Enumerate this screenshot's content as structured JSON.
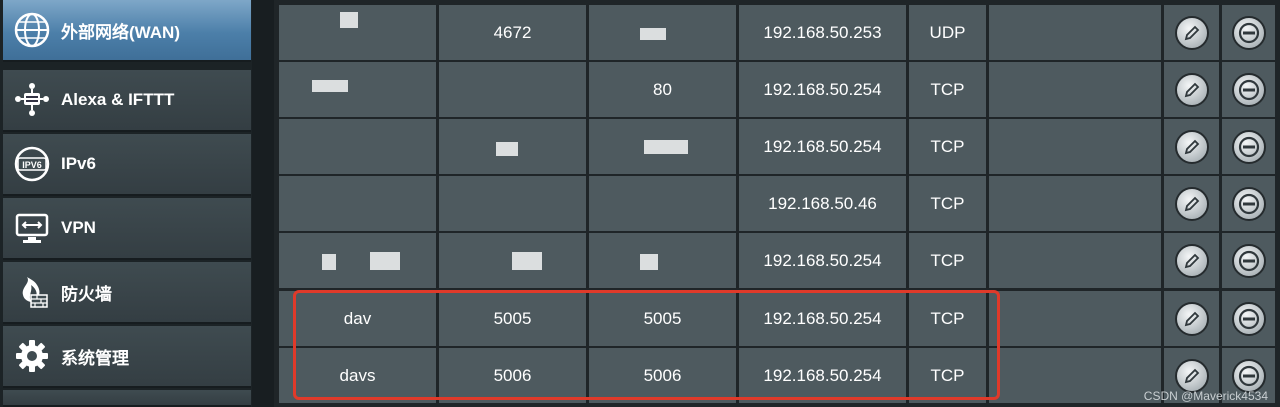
{
  "sidebar": {
    "items": [
      {
        "label": "外部网络(WAN)",
        "icon": "globe-icon",
        "active": true
      },
      {
        "label": "Alexa & IFTTT",
        "icon": "alexa-device-icon",
        "active": false
      },
      {
        "label": "IPv6",
        "icon": "ipv6-icon",
        "active": false
      },
      {
        "label": "VPN",
        "icon": "vpn-monitor-icon",
        "active": false
      },
      {
        "label": "防火墙",
        "icon": "firewall-icon",
        "active": false
      },
      {
        "label": "系统管理",
        "icon": "gear-icon",
        "active": false
      }
    ]
  },
  "table": {
    "rows": [
      {
        "name": "",
        "external_port": "4672",
        "internal_port": "",
        "ip": "192.168.50.253",
        "protocol": "UDP",
        "source": ""
      },
      {
        "name": "",
        "external_port": "",
        "internal_port": "80",
        "ip": "192.168.50.254",
        "protocol": "TCP",
        "source": ""
      },
      {
        "name": "",
        "external_port": "",
        "internal_port": "",
        "ip": "192.168.50.254",
        "protocol": "TCP",
        "source": ""
      },
      {
        "name": "",
        "external_port": "",
        "internal_port": "",
        "ip": "192.168.50.46",
        "protocol": "TCP",
        "source": ""
      },
      {
        "name": "",
        "external_port": "",
        "internal_port": "",
        "ip": "192.168.50.254",
        "protocol": "TCP",
        "source": ""
      },
      {
        "name": "dav",
        "external_port": "5005",
        "internal_port": "5005",
        "ip": "192.168.50.254",
        "protocol": "TCP",
        "source": ""
      },
      {
        "name": "davs",
        "external_port": "5006",
        "internal_port": "5006",
        "ip": "192.168.50.254",
        "protocol": "TCP",
        "source": ""
      }
    ],
    "edit_icon": "pencil-icon",
    "delete_icon": "minus-icon"
  },
  "watermark": "CSDN @Maverick4534",
  "colors": {
    "highlight": "#e03a2a",
    "active_menu": "#4c7fa9",
    "cell_bg": "#4e5a5f"
  }
}
